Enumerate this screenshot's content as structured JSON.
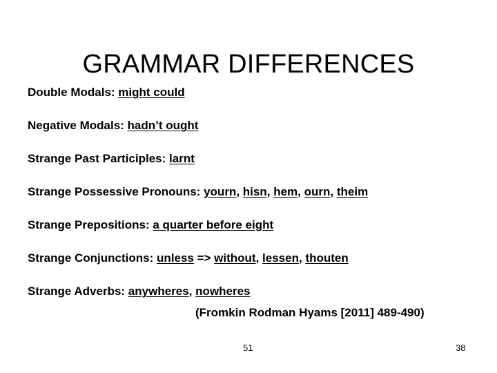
{
  "slide": {
    "title": "GRAMMAR DIFFERENCES",
    "background_color": "#ffffff",
    "text_color": "#000000",
    "bullets": [
      {
        "label": "Double Modals: ",
        "parts": [
          {
            "text": "might could",
            "underline": true
          }
        ]
      },
      {
        "label": "Negative Modals: ",
        "parts": [
          {
            "text": "hadn’t ought",
            "underline": true
          }
        ]
      },
      {
        "label": "Strange Past Participles: ",
        "parts": [
          {
            "text": "larnt",
            "underline": true
          }
        ]
      },
      {
        "label": "Strange Possessive Pronouns: ",
        "parts": [
          {
            "text": "yourn",
            "underline": true
          },
          {
            "text": ", ",
            "underline": false
          },
          {
            "text": "hisn",
            "underline": true
          },
          {
            "text": ", ",
            "underline": false
          },
          {
            "text": "hem",
            "underline": true
          },
          {
            "text": ", ",
            "underline": false
          },
          {
            "text": "ourn",
            "underline": true
          },
          {
            "text": ", ",
            "underline": false
          },
          {
            "text": "theim",
            "underline": true
          }
        ]
      },
      {
        "label": "Strange Prepositions: ",
        "parts": [
          {
            "text": "a quarter before eight",
            "underline": true
          }
        ]
      },
      {
        "label": "Strange Conjunctions: ",
        "parts": [
          {
            "text": "unless",
            "underline": true
          },
          {
            "text": " => ",
            "underline": false
          },
          {
            "text": "without",
            "underline": true
          },
          {
            "text": ", ",
            "underline": false
          },
          {
            "text": "lessen",
            "underline": true
          },
          {
            "text": ", ",
            "underline": false
          },
          {
            "text": "thouten",
            "underline": true
          }
        ]
      },
      {
        "label": "Strange Adverbs: ",
        "parts": [
          {
            "text": "anywheres",
            "underline": true
          },
          {
            "text": ", ",
            "underline": false
          },
          {
            "text": "nowheres",
            "underline": true
          }
        ]
      }
    ],
    "attribution": "(Fromkin Rodman Hyams [2011] 489-490)",
    "footer": {
      "center_number": "51",
      "right_number": "38"
    }
  }
}
